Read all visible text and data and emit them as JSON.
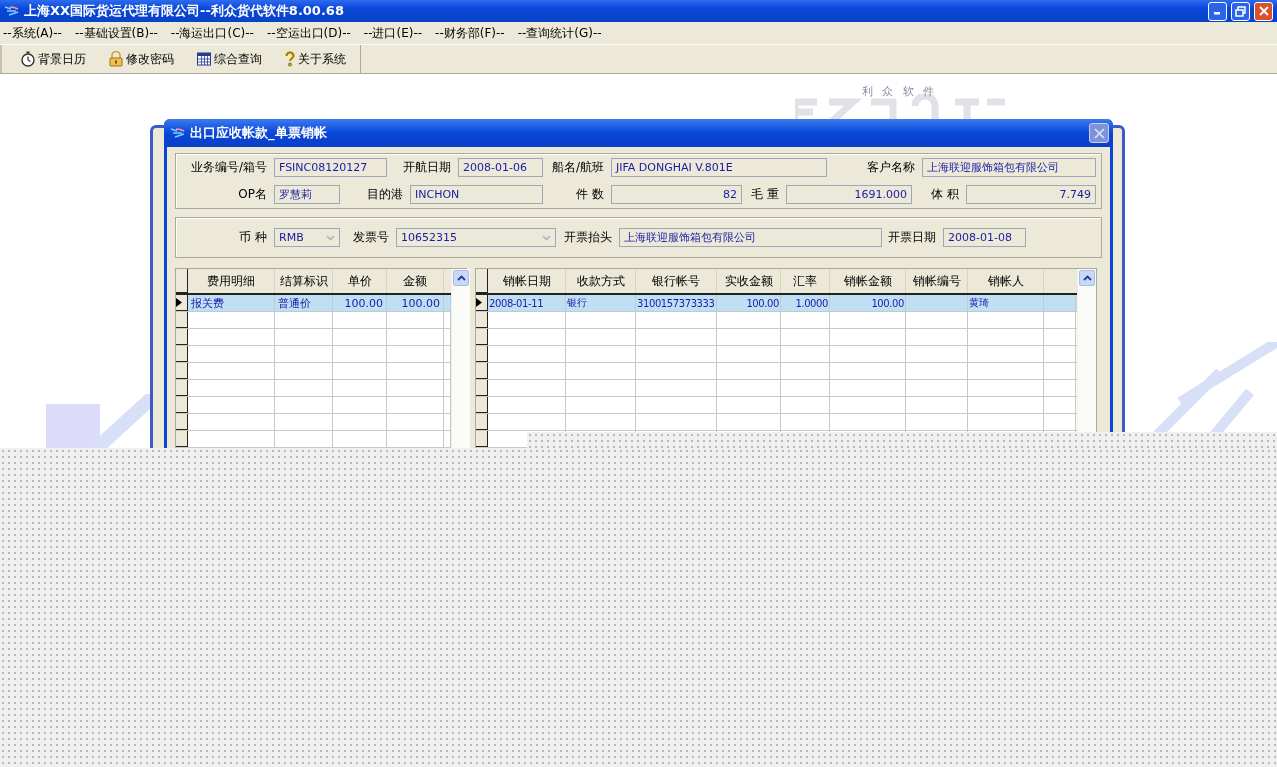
{
  "window": {
    "title": "上海XX国际货运代理有限公司--利众货代软件8.00.68"
  },
  "menu": [
    "--系统(A)--",
    "--基础设置(B)--",
    "--海运出口(C)--",
    "--空运出口(D)--",
    "--进口(E)--",
    "--财务部(F)--",
    "--查询统计(G)--"
  ],
  "toolbar": [
    "背景日历",
    "修改密码",
    "综合查询",
    "关于系统"
  ],
  "background_logo": {
    "caption": "利 众 软 件"
  },
  "dialog": {
    "title": "出口应收帐款_单票销帐",
    "field_rows": [
      [
        {
          "label": "业务编号/箱号",
          "value": "FSINC08120127",
          "kind": "text"
        },
        {
          "label": "开航日期",
          "value": "2008-01-06",
          "kind": "text"
        },
        {
          "label": "船名/航班",
          "value": "JIFA DONGHAI V.801E",
          "kind": "text"
        },
        {
          "label": "客户名称",
          "value": "上海联迎服饰箱包有限公司",
          "kind": "text"
        }
      ],
      [
        {
          "label": "OP名",
          "value": "罗慧莉",
          "kind": "text"
        },
        {
          "label": "目的港",
          "value": "INCHON",
          "kind": "text"
        },
        {
          "label": "件 数",
          "value": "82",
          "kind": "number"
        },
        {
          "label": "毛 重",
          "value": "1691.000",
          "kind": "number"
        },
        {
          "label": "体 积",
          "value": "7.749",
          "kind": "number"
        }
      ],
      [
        {
          "label": "币 种",
          "value": "RMB",
          "kind": "combo"
        },
        {
          "label": "发票号",
          "value": "10652315",
          "kind": "combo"
        },
        {
          "label": "开票抬头",
          "value": "上海联迎服饰箱包有限公司",
          "kind": "text"
        },
        {
          "label": "开票日期",
          "value": "2008-01-08",
          "kind": "text"
        }
      ]
    ],
    "fee_grid": {
      "columns": [
        "费用明细",
        "结算标识",
        "单价",
        "金额"
      ],
      "rows": [
        {
          "cells": [
            "报关费",
            "普通价",
            "100.00",
            "100.00"
          ],
          "selected": true
        }
      ]
    },
    "writeoff_grid": {
      "columns": [
        "销帐日期",
        "收款方式",
        "银行帐号",
        "实收金额",
        "汇率",
        "销帐金额",
        "销帐编号",
        "销帐人"
      ],
      "rows": [
        {
          "cells": [
            "2008-01-11",
            "银行",
            "3100157373333",
            "100.00",
            "1.0000",
            "100.00",
            "",
            "黄琦"
          ],
          "selected": true
        }
      ]
    }
  }
}
